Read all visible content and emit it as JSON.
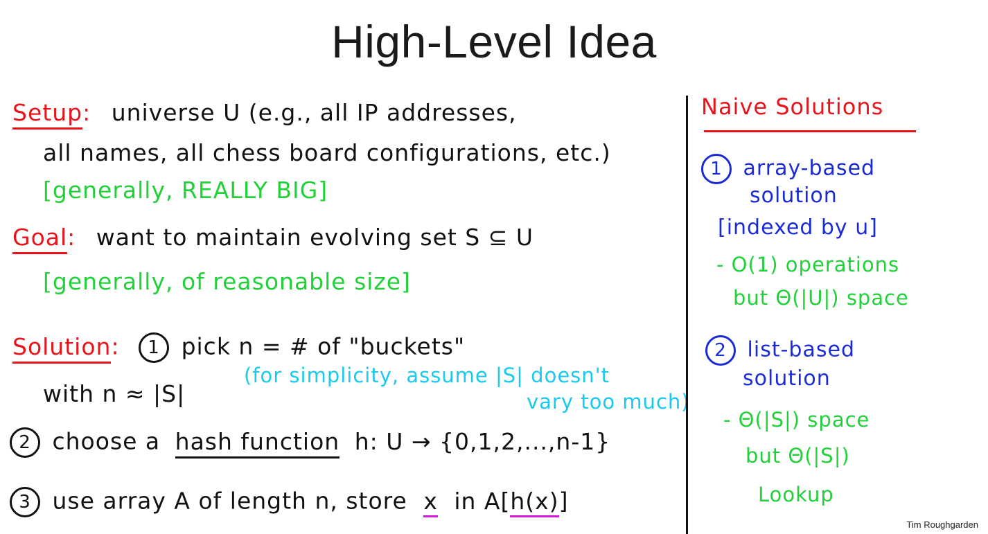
{
  "title": "High-Level Idea",
  "left": {
    "setup_label": "Setup",
    "setup_colon": ":",
    "setup_line1": "universe U (e.g., all IP addresses,",
    "setup_line2": "all names, all chess board configurations, etc.)",
    "setup_note": "[generally, REALLY BIG]",
    "goal_label": "Goal",
    "goal_colon": ":",
    "goal_line1": "want to maintain evolving set S ⊆ U",
    "goal_note": "[generally, of reasonable size]",
    "solution_label": "Solution",
    "solution_colon": ":",
    "step1_num": "1",
    "step1_text": "pick n = # of \"buckets\"",
    "step1_line2": "with n ≈ |S|",
    "step1_note_line1": "(for simplicity, assume |S| doesn't",
    "step1_note_line2": "vary too much)",
    "step2_num": "2",
    "step2_pre": "choose a",
    "step2_term": "hash function",
    "step2_post": "h: U → {0,1,2,...,n-1}",
    "step3_num": "3",
    "step3_pre": "use array A of length n, store",
    "step3_x": "x",
    "step3_mid": "in A[",
    "step3_hx": "h(x)",
    "step3_end": "]"
  },
  "right": {
    "heading": "Naive Solutions",
    "sol1_num": "1",
    "sol1_line1": "array-based",
    "sol1_line2": "solution",
    "sol1_line3": "[indexed by u]",
    "sol1_note1": "- O(1) operations",
    "sol1_note2": "but Θ(|U|) space",
    "sol2_num": "2",
    "sol2_line1": "list-based",
    "sol2_line2": "solution",
    "sol2_note1": "- Θ(|S|) space",
    "sol2_note2": "but Θ(|S|)",
    "sol2_note3": "Lookup"
  },
  "credit": "Tim Roughgarden"
}
